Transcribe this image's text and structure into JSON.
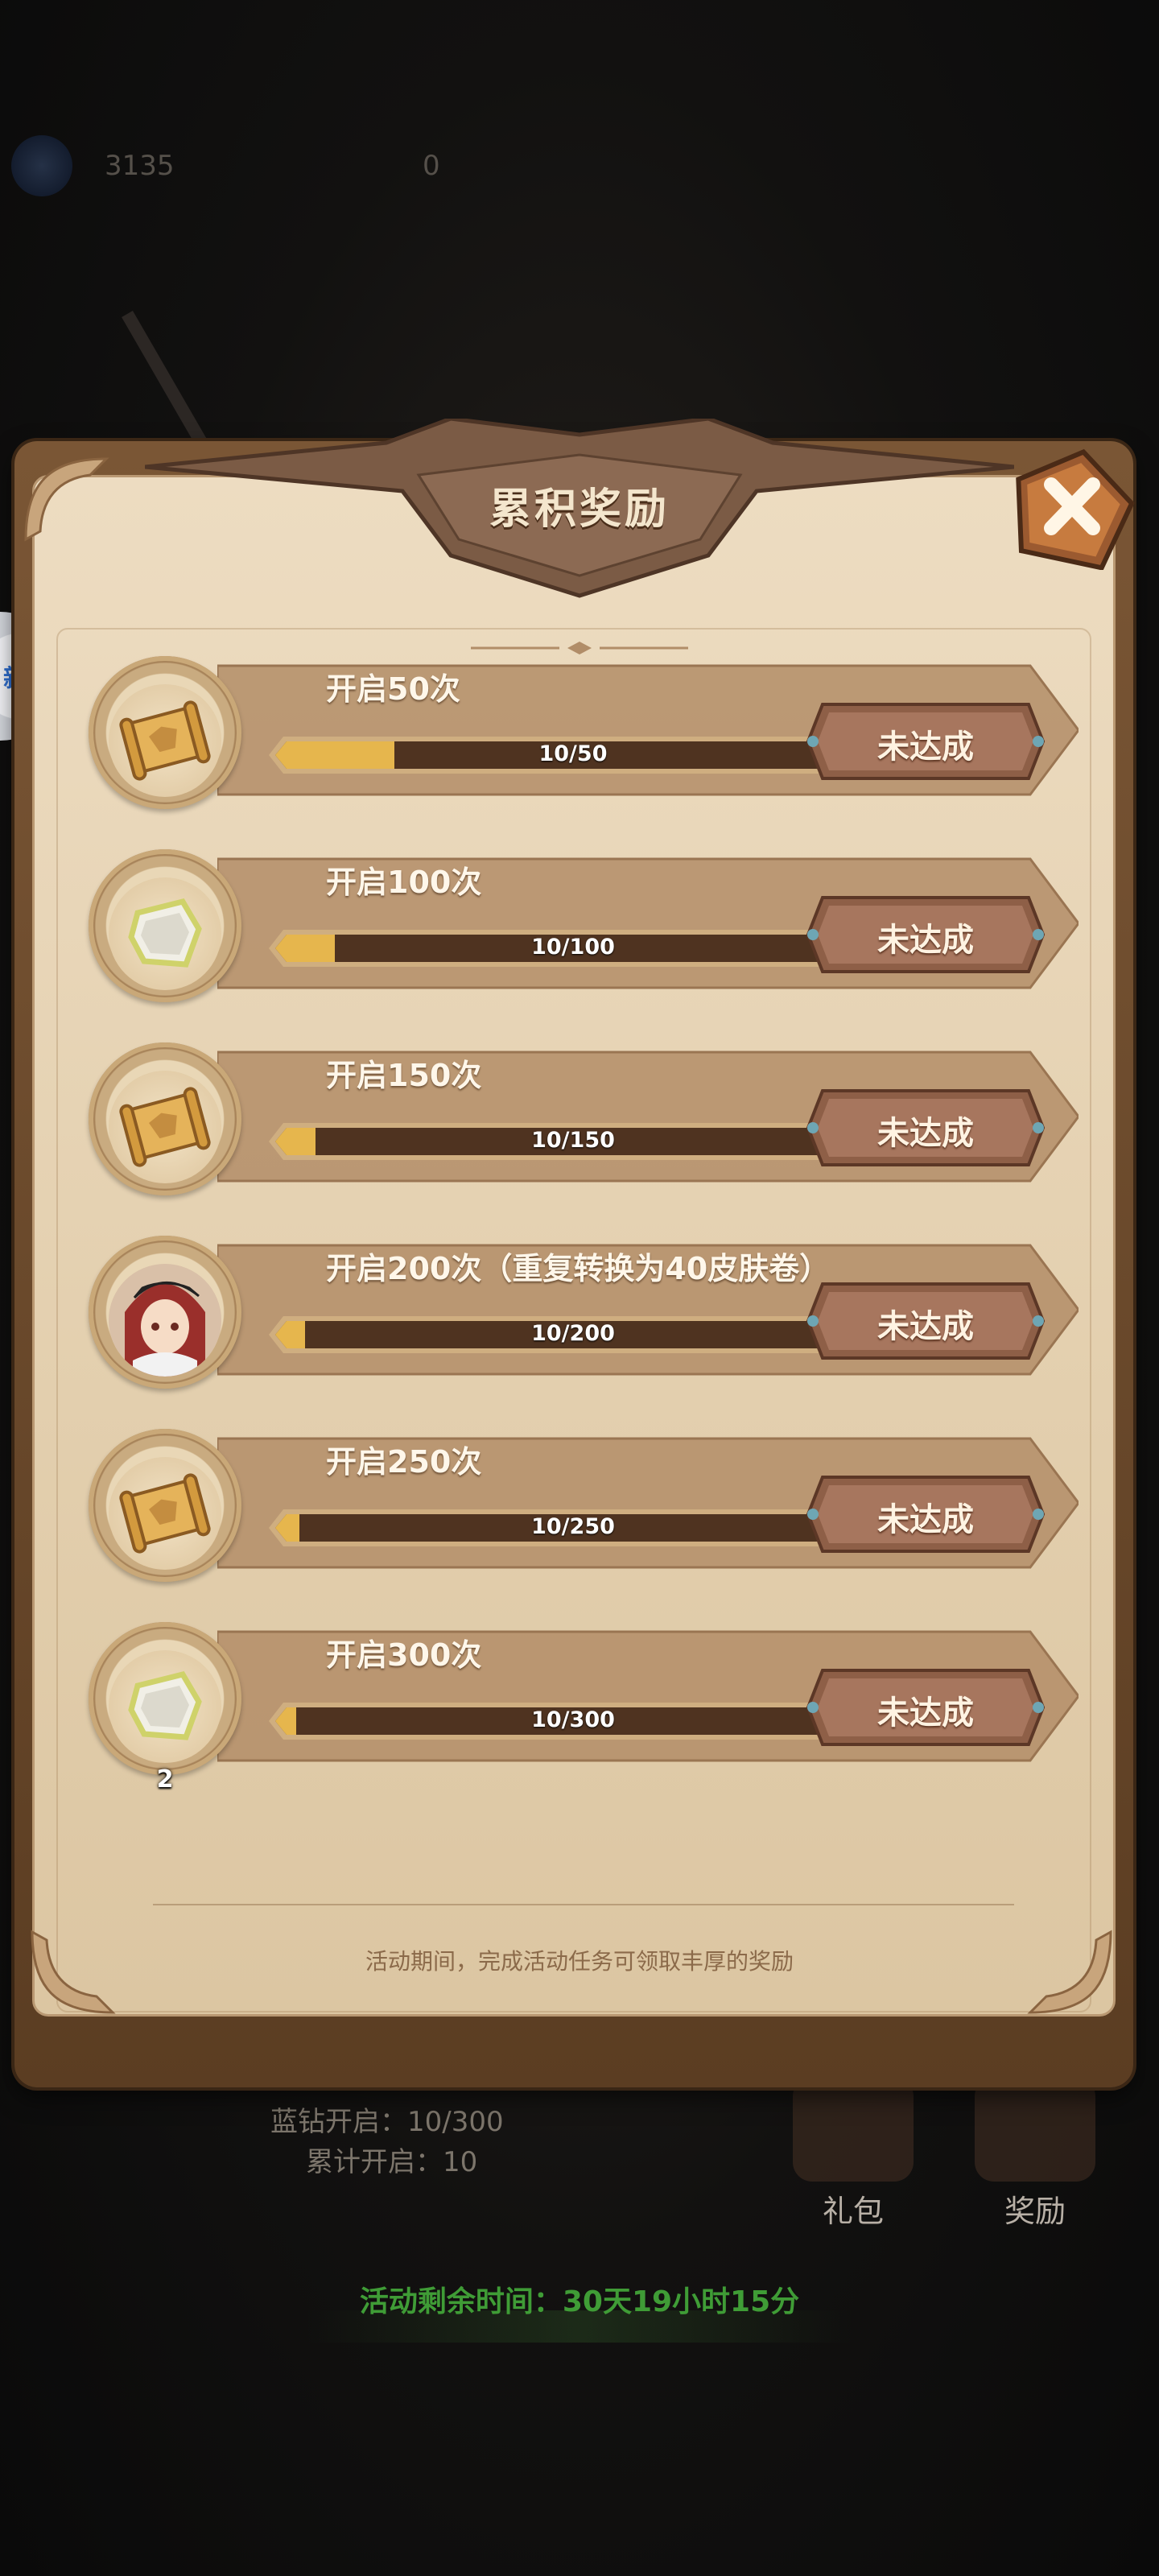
{
  "background": {
    "currency_a": "3135",
    "currency_b": "0",
    "side_badge_text": "新游"
  },
  "panel": {
    "title": "累积奖励",
    "close_icon": "close-icon",
    "footer_note": "活动期间，完成活动任务可领取丰厚的奖励"
  },
  "rewards": [
    {
      "title": "开启50次",
      "progress": "10/50",
      "ratio": 0.2,
      "status": "未达成",
      "icon": "scroll-icon",
      "count": ""
    },
    {
      "title": "开启100次",
      "progress": "10/100",
      "ratio": 0.1,
      "status": "未达成",
      "icon": "stone-icon",
      "count": ""
    },
    {
      "title": "开启150次",
      "progress": "10/150",
      "ratio": 0.067,
      "status": "未达成",
      "icon": "scroll-icon",
      "count": ""
    },
    {
      "title": "开启200次（重复转换为40皮肤卷）",
      "progress": "10/200",
      "ratio": 0.05,
      "status": "未达成",
      "icon": "hero-portrait-icon",
      "count": ""
    },
    {
      "title": "开启250次",
      "progress": "10/250",
      "ratio": 0.04,
      "status": "未达成",
      "icon": "scroll-icon",
      "count": ""
    },
    {
      "title": "开启300次",
      "progress": "10/300",
      "ratio": 0.033,
      "status": "未达成",
      "icon": "stone-icon",
      "count": "2"
    }
  ],
  "bottom": {
    "stat_open": "蓝钻开启：10/300",
    "stat_total": "累计开启：10",
    "gift_label": "礼包",
    "reward_label": "奖励",
    "timer": "活动剩余时间：30天19小时15分"
  }
}
